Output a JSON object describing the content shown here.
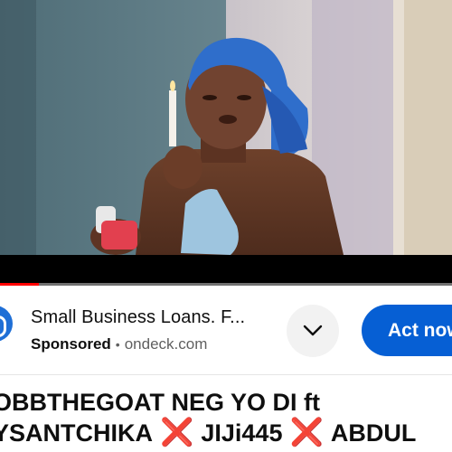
{
  "player": {
    "progress_fraction": 0.085
  },
  "ad": {
    "title": "Small Business Loans. F...",
    "sponsored_label": "Sponsored",
    "separator": "•",
    "domain": "ondeck.com",
    "more_icon": "chevron-down-icon",
    "cta_label": "Act now",
    "cta_color": "#065fd4"
  },
  "video": {
    "title_line1": "OBBTHEGOAT NEG YO DI ft",
    "title_line2_part1": "YSANTCHIKA",
    "title_line2_part2": "JIJi445",
    "title_line2_part3": "ABDUL",
    "separator_glyph": "❌"
  }
}
